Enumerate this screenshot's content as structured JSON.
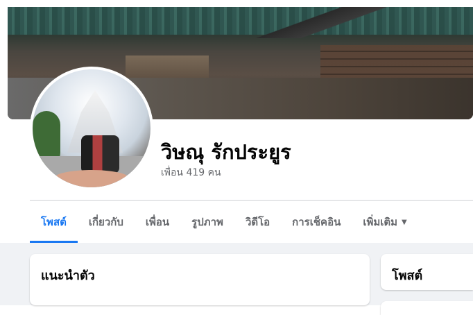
{
  "profile": {
    "name": "วิษณุ รักประยูร",
    "friends_count": "เพื่อน 419 คน"
  },
  "tabs": [
    {
      "label": "โพสต์",
      "active": true
    },
    {
      "label": "เกี่ยวกับ",
      "active": false
    },
    {
      "label": "เพื่อน",
      "active": false
    },
    {
      "label": "รูปภาพ",
      "active": false
    },
    {
      "label": "วิดีโอ",
      "active": false
    },
    {
      "label": "การเช็คอิน",
      "active": false
    },
    {
      "label": "เพิ่มเติม",
      "active": false,
      "icon": "chevron-down-icon"
    }
  ],
  "cards": {
    "intro_title": "แนะนำตัว",
    "posts_title": "โพสต์"
  },
  "colors": {
    "accent": "#1877f2",
    "muted_text": "#65676b",
    "page_bg": "#f0f2f5"
  }
}
